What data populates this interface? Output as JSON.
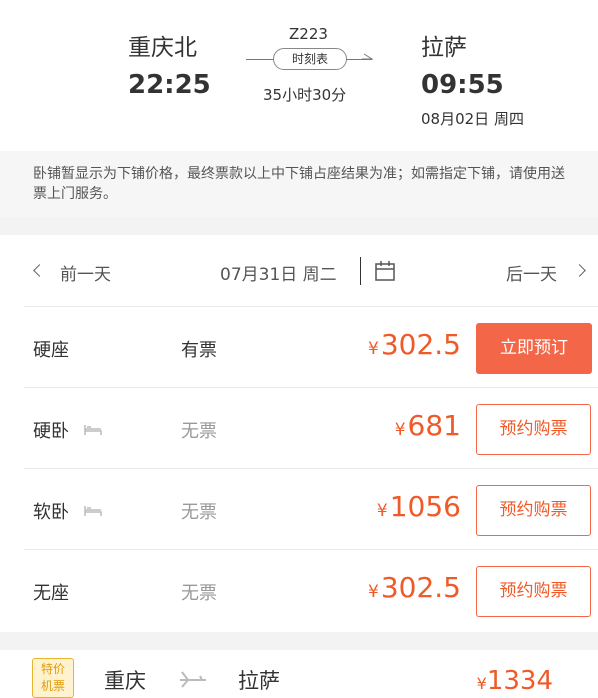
{
  "train": {
    "number": "Z223",
    "schedule_label": "时刻表",
    "duration": "35小时30分",
    "departure": {
      "station": "重庆北",
      "time": "22:25"
    },
    "arrival": {
      "station": "拉萨",
      "time": "09:55",
      "date": "08月02日 周四"
    }
  },
  "notice": "卧铺暂显示为下铺价格，最终票款以上中下铺占座结果为准；如需指定下铺，请使用送票上门服务。",
  "date_nav": {
    "prev_label": "前一天",
    "current_date": "07月31日 周二",
    "next_label": "后一天"
  },
  "seats": [
    {
      "type": "硬座",
      "has_bed_icon": false,
      "availability": "有票",
      "price": "302.5",
      "action": "立即预订"
    },
    {
      "type": "硬卧",
      "has_bed_icon": true,
      "availability": "无票",
      "price": "681",
      "action": "预约购票"
    },
    {
      "type": "软卧",
      "has_bed_icon": true,
      "availability": "无票",
      "price": "1056",
      "action": "预约购票"
    },
    {
      "type": "无座",
      "has_bed_icon": false,
      "availability": "无票",
      "price": "302.5",
      "action": "预约购票"
    }
  ],
  "currency_symbol": "¥",
  "promo": {
    "badge_line1": "特价",
    "badge_line2": "机票",
    "from": "重庆",
    "to": "拉萨",
    "price": "1334"
  },
  "colors": {
    "accent": "#f46648",
    "price": "#f05a28"
  }
}
